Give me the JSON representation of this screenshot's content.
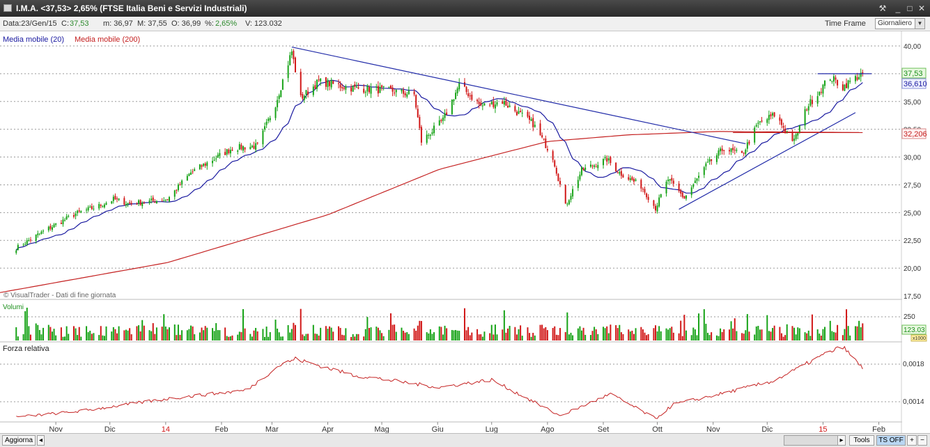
{
  "window": {
    "title": "I.M.A. <37,53> 2,65%  (FTSE Italia Beni e Servizi Industriali)",
    "buttons": [
      "⚒",
      "_",
      "□",
      "✕"
    ]
  },
  "infobar": {
    "date": "Data:23/Gen/15",
    "close_label": "C:",
    "close_value": "37,53",
    "min": "m: 36,97",
    "max": "M: 37,55",
    "open": "O: 36,99",
    "pct_label": "%:",
    "pct_value": "2,65%",
    "volume": "V: 123.032",
    "timeframe_label": "Time Frame",
    "timeframe_value": "Giornaliero"
  },
  "colors": {
    "bull": "#17a317",
    "bear": "#d11818",
    "ma20": "#1a1aa0",
    "ma200": "#c42020",
    "trend": "#202aa8",
    "grid": "#9a9a9a"
  },
  "main_panel": {
    "legend_ma20": "Media mobile (20)",
    "legend_ma200": "Media mobile (200)",
    "watermark": "© VisualTrader - Dati di fine giornata",
    "price_badge": "37,53",
    "ma20_badge": "36,610",
    "ma200_badge": "32,206",
    "ticks": [
      "40,00",
      "37,50",
      "35,00",
      "32,50",
      "30,00",
      "27,50",
      "25,00",
      "22,50",
      "20,00",
      "17,50"
    ]
  },
  "volume_panel": {
    "label": "Volumi",
    "tick": "250",
    "badge": "123.03",
    "multiplier": "x1000"
  },
  "rs_panel": {
    "label": "Forza relativa",
    "tick_high": "0,0018",
    "tick_low": "0,0014"
  },
  "x_axis": {
    "months": [
      {
        "label": "Nov",
        "red": false
      },
      {
        "label": "Dic",
        "red": false
      },
      {
        "label": "14",
        "red": true
      },
      {
        "label": "Feb",
        "red": false
      },
      {
        "label": "Mar",
        "red": false
      },
      {
        "label": "Apr",
        "red": false
      },
      {
        "label": "Mag",
        "red": false
      },
      {
        "label": "Giu",
        "red": false
      },
      {
        "label": "Lug",
        "red": false
      },
      {
        "label": "Ago",
        "red": false
      },
      {
        "label": "Set",
        "red": false
      },
      {
        "label": "Ott",
        "red": false
      },
      {
        "label": "Nov",
        "red": false
      },
      {
        "label": "Dic",
        "red": false
      },
      {
        "label": "15",
        "red": true
      },
      {
        "label": "Feb",
        "red": false
      }
    ]
  },
  "bottombar": {
    "refresh": "Aggiorna",
    "tools": "Tools",
    "ts": "TS OFF",
    "plus": "+",
    "minus": "−"
  },
  "chart_data": {
    "type": "candlestick",
    "price_ylim": [
      17.5,
      40
    ],
    "price_anchors": [
      {
        "date": "2013-10-10",
        "price": 21.8
      },
      {
        "date": "2013-10-25",
        "price": 23.3
      },
      {
        "date": "2013-11-12",
        "price": 24.9
      },
      {
        "date": "2013-11-25",
        "price": 25.6
      },
      {
        "date": "2013-12-03",
        "price": 26.2
      },
      {
        "date": "2013-12-12",
        "price": 25.8
      },
      {
        "date": "2014-01-02",
        "price": 26.2
      },
      {
        "date": "2014-01-15",
        "price": 28.6
      },
      {
        "date": "2014-02-07",
        "price": 30.8
      },
      {
        "date": "2014-02-21",
        "price": 31.0
      },
      {
        "date": "2014-03-03",
        "price": 34.8
      },
      {
        "date": "2014-03-12",
        "price": 39.5
      },
      {
        "date": "2014-03-17",
        "price": 35.3
      },
      {
        "date": "2014-03-27",
        "price": 36.8
      },
      {
        "date": "2014-04-15",
        "price": 36.2
      },
      {
        "date": "2014-05-05",
        "price": 36.0
      },
      {
        "date": "2014-05-19",
        "price": 35.6
      },
      {
        "date": "2014-05-23",
        "price": 31.4
      },
      {
        "date": "2014-06-04",
        "price": 33.3
      },
      {
        "date": "2014-06-13",
        "price": 36.5
      },
      {
        "date": "2014-06-25",
        "price": 34.6
      },
      {
        "date": "2014-07-07",
        "price": 35.0
      },
      {
        "date": "2014-07-24",
        "price": 33.0
      },
      {
        "date": "2014-08-04",
        "price": 30.0
      },
      {
        "date": "2014-08-11",
        "price": 25.6
      },
      {
        "date": "2014-08-20",
        "price": 28.8
      },
      {
        "date": "2014-09-03",
        "price": 29.8
      },
      {
        "date": "2014-09-10",
        "price": 28.6
      },
      {
        "date": "2014-09-22",
        "price": 27.4
      },
      {
        "date": "2014-09-30",
        "price": 25.4
      },
      {
        "date": "2014-10-07",
        "price": 28.0
      },
      {
        "date": "2014-10-16",
        "price": 26.3
      },
      {
        "date": "2014-10-28",
        "price": 29.2
      },
      {
        "date": "2014-11-07",
        "price": 30.8
      },
      {
        "date": "2014-11-17",
        "price": 30.2
      },
      {
        "date": "2014-11-26",
        "price": 33.0
      },
      {
        "date": "2014-12-05",
        "price": 33.8
      },
      {
        "date": "2014-12-16",
        "price": 31.4
      },
      {
        "date": "2014-12-23",
        "price": 34.5
      },
      {
        "date": "2015-01-05",
        "price": 37.2
      },
      {
        "date": "2015-01-12",
        "price": 36.3
      },
      {
        "date": "2015-01-16",
        "price": 36.8
      },
      {
        "date": "2015-01-23",
        "price": 37.53
      }
    ],
    "ma200_anchors": [
      {
        "date": "2013-10-01",
        "value": 17.8
      },
      {
        "date": "2014-01-02",
        "value": 20.5
      },
      {
        "date": "2014-04-01",
        "value": 24.8
      },
      {
        "date": "2014-06-02",
        "value": 28.9
      },
      {
        "date": "2014-08-01",
        "value": 31.4
      },
      {
        "date": "2014-09-15",
        "value": 32.0
      },
      {
        "date": "2014-11-03",
        "value": 32.3
      },
      {
        "date": "2015-01-23",
        "value": 32.206
      }
    ],
    "trendlines": [
      {
        "from": {
          "date": "2014-03-12",
          "price": 39.9
        },
        "to": {
          "date": "2014-11-19",
          "price": 31.2
        }
      },
      {
        "from": {
          "date": "2014-10-13",
          "price": 25.3
        },
        "to": {
          "date": "2015-01-19",
          "price": 34.0
        }
      },
      {
        "from": {
          "date": "2014-12-29",
          "price": 37.5
        },
        "to": {
          "date": "2015-01-28",
          "price": 37.5
        }
      },
      {
        "from": {
          "date": "2014-11-12",
          "price": 32.2
        },
        "to": {
          "date": "2015-01-23",
          "price": 32.2
        }
      }
    ],
    "volume_tick": 250,
    "last_volume": 123.03,
    "rs_ticks": [
      0.0014,
      0.0018
    ],
    "rs_anchors": [
      {
        "date": "2013-10-01",
        "value": 0.00122
      },
      {
        "date": "2013-11-15",
        "value": 0.0013
      },
      {
        "date": "2014-01-02",
        "value": 0.00143
      },
      {
        "date": "2014-02-15",
        "value": 0.00152
      },
      {
        "date": "2014-03-05",
        "value": 0.00178
      },
      {
        "date": "2014-03-14",
        "value": 0.00185
      },
      {
        "date": "2014-04-15",
        "value": 0.00168
      },
      {
        "date": "2014-06-02",
        "value": 0.00155
      },
      {
        "date": "2014-07-01",
        "value": 0.00163
      },
      {
        "date": "2014-08-08",
        "value": 0.00125
      },
      {
        "date": "2014-09-05",
        "value": 0.00148
      },
      {
        "date": "2014-09-30",
        "value": 0.00122
      },
      {
        "date": "2014-10-10",
        "value": 0.00137
      },
      {
        "date": "2014-11-05",
        "value": 0.00148
      },
      {
        "date": "2014-12-05",
        "value": 0.00162
      },
      {
        "date": "2015-01-02",
        "value": 0.0019
      },
      {
        "date": "2015-01-12",
        "value": 0.00198
      },
      {
        "date": "2015-01-23",
        "value": 0.00175
      }
    ]
  }
}
